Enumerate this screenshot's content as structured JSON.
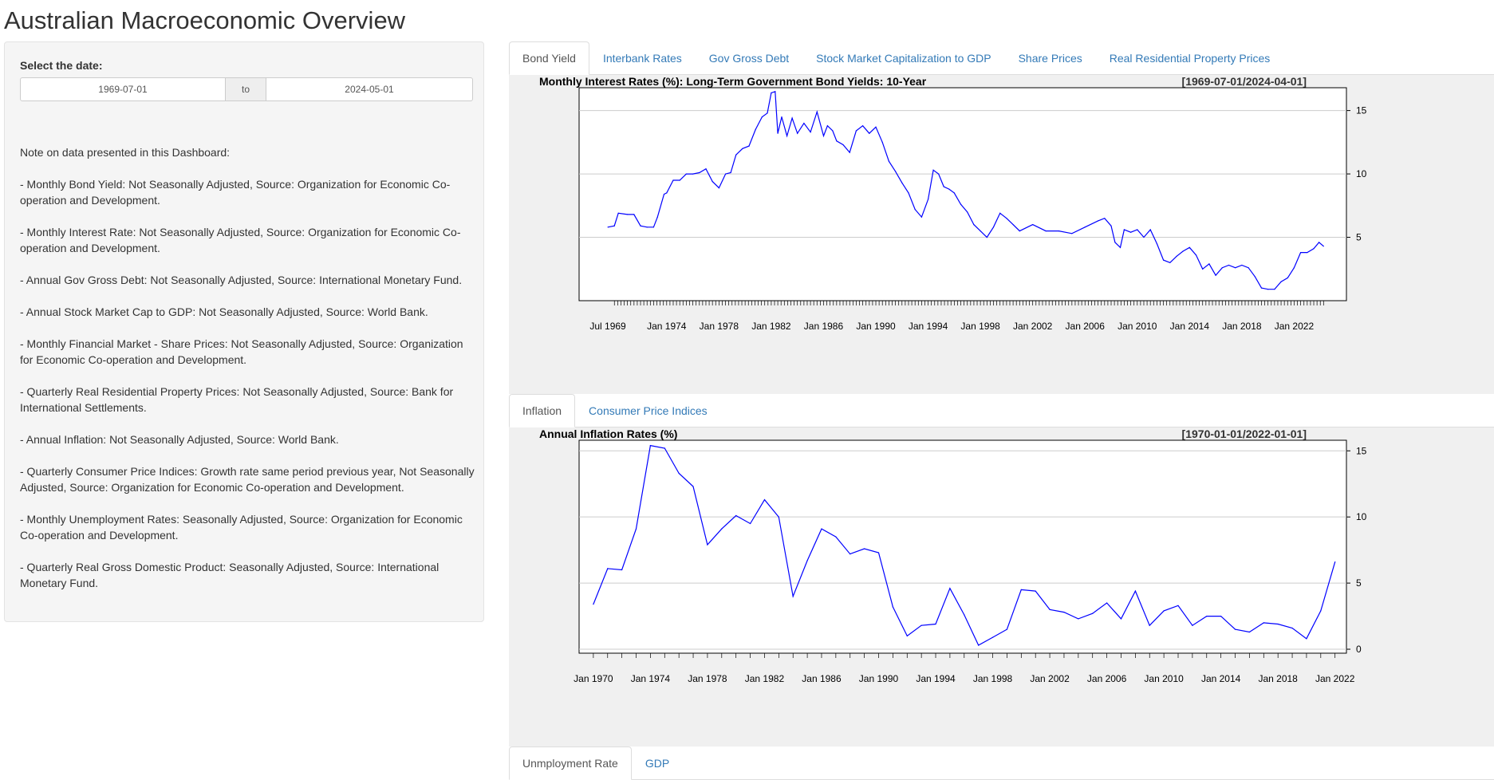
{
  "page": {
    "title": "Australian Macroeconomic Overview"
  },
  "sidebar": {
    "date_label": "Select the date:",
    "date_start": "1969-07-01",
    "date_separator": "to",
    "date_end": "2024-05-01",
    "notes_heading": "Note on data presented in this Dashboard:",
    "notes": [
      "- Monthly Bond Yield: Not Seasonally Adjusted, Source: Organization for Economic Co-operation and Development.",
      "- Monthly Interest Rate: Not Seasonally Adjusted, Source: Organization for Economic Co-operation and Development.",
      "- Annual Gov Gross Debt: Not Seasonally Adjusted, Source: International Monetary Fund.",
      "- Annual Stock Market Cap to GDP: Not Seasonally Adjusted, Source: World Bank.",
      "- Monthly Financial Market - Share Prices: Not Seasonally Adjusted, Source: Organization for Economic Co-operation and Development.",
      "- Quarterly Real Residential Property Prices: Not Seasonally Adjusted, Source: Bank for International Settlements.",
      "- Annual Inflation: Not Seasonally Adjusted, Source: World Bank.",
      "- Quarterly Consumer Price Indices: Growth rate same period previous year, Not Seasonally Adjusted, Source: Organization for Economic Co-operation and Development.",
      "- Monthly Unemployment Rates: Seasonally Adjusted, Source: Organization for Economic Co-operation and Development.",
      "- Quarterly Real Gross Domestic Product: Seasonally Adjusted, Source: International Monetary Fund."
    ]
  },
  "tabset1": {
    "tabs": [
      "Bond Yield",
      "Interbank Rates",
      "Gov Gross Debt",
      "Stock Market Capitalization to GDP",
      "Share Prices",
      "Real Residential Property Prices"
    ],
    "active": 0
  },
  "tabset2": {
    "tabs": [
      "Inflation",
      "Consumer Price Indices"
    ],
    "active": 0
  },
  "tabset3": {
    "tabs": [
      "Unmployment Rate",
      "GDP"
    ],
    "active": 0
  },
  "colors": {
    "line": "#0000ff",
    "tab_link": "#337ab7",
    "panel_bg": "#f0f0f0"
  },
  "chart_data": [
    {
      "type": "line",
      "title": "Monthly Interest Rates (%): Long-Term Government Bond Yields: 10-Year",
      "range_label": "[1969-07-01/2024-04-01]",
      "x_ticks": [
        "Jul 1969",
        "Jan 1974",
        "Jan 1978",
        "Jan 1982",
        "Jan 1986",
        "Jan 1990",
        "Jan 1994",
        "Jan 1998",
        "Jan 2002",
        "Jan 2006",
        "Jan 2010",
        "Jan 2014",
        "Jan 2018",
        "Jan 2022"
      ],
      "x_tick_years": [
        1969.5,
        1974,
        1978,
        1982,
        1986,
        1990,
        1994,
        1998,
        2002,
        2006,
        2010,
        2014,
        2018,
        2022
      ],
      "xlim": [
        1967.3,
        2026.0
      ],
      "ylim": [
        0,
        16.8
      ],
      "y_ticks": [
        5,
        10,
        15
      ],
      "grid": true,
      "x": [
        1969.5,
        1970.0,
        1970.3,
        1971.0,
        1971.5,
        1972.0,
        1972.5,
        1973.0,
        1973.3,
        1973.8,
        1974.0,
        1974.5,
        1975.0,
        1975.5,
        1976.0,
        1976.5,
        1977.0,
        1977.5,
        1978.0,
        1978.5,
        1978.9,
        1979.3,
        1979.8,
        1980.3,
        1980.8,
        1981.3,
        1981.7,
        1982.0,
        1982.3,
        1982.5,
        1982.8,
        1983.2,
        1983.6,
        1984.0,
        1984.5,
        1985.0,
        1985.5,
        1986.0,
        1986.3,
        1986.7,
        1987.0,
        1987.5,
        1988.0,
        1988.5,
        1989.0,
        1989.5,
        1990.0,
        1990.5,
        1991.0,
        1991.5,
        1992.0,
        1992.5,
        1993.0,
        1993.5,
        1994.0,
        1994.4,
        1994.8,
        1995.2,
        1995.6,
        1996.0,
        1996.5,
        1997.0,
        1997.5,
        1998.0,
        1998.5,
        1999.0,
        1999.5,
        2000.0,
        2000.5,
        2001.0,
        2002.0,
        2003.0,
        2004.0,
        2005.0,
        2006.0,
        2007.0,
        2007.5,
        2008.0,
        2008.3,
        2008.7,
        2009.0,
        2009.5,
        2010.0,
        2010.5,
        2011.0,
        2011.5,
        2012.0,
        2012.5,
        2013.0,
        2013.5,
        2014.0,
        2014.5,
        2015.0,
        2015.5,
        2016.0,
        2016.5,
        2017.0,
        2017.5,
        2018.0,
        2018.5,
        2019.0,
        2019.5,
        2020.0,
        2020.5,
        2021.0,
        2021.5,
        2022.0,
        2022.5,
        2023.0,
        2023.5,
        2023.9,
        2024.25
      ],
      "y": [
        5.8,
        5.9,
        6.9,
        6.8,
        6.8,
        5.9,
        5.8,
        5.8,
        6.6,
        8.4,
        8.5,
        9.5,
        9.5,
        10.0,
        10.0,
        10.1,
        10.4,
        9.4,
        8.9,
        10.0,
        10.1,
        11.5,
        12.0,
        12.2,
        13.5,
        14.5,
        14.8,
        16.4,
        16.5,
        13.2,
        14.5,
        13.0,
        14.4,
        13.2,
        14.0,
        13.3,
        14.9,
        13.0,
        13.8,
        13.4,
        12.6,
        12.3,
        11.7,
        13.4,
        13.8,
        13.2,
        13.7,
        12.5,
        11.0,
        10.2,
        9.3,
        8.5,
        7.2,
        6.6,
        8.0,
        10.3,
        10.0,
        9.0,
        8.8,
        8.5,
        7.6,
        7.0,
        6.0,
        5.5,
        5.0,
        5.8,
        6.9,
        6.5,
        6.0,
        5.5,
        6.0,
        5.5,
        5.5,
        5.3,
        5.8,
        6.3,
        6.5,
        5.9,
        4.6,
        4.2,
        5.6,
        5.4,
        5.6,
        5.0,
        5.6,
        4.5,
        3.2,
        3.0,
        3.5,
        3.9,
        4.2,
        3.6,
        2.5,
        2.9,
        2.0,
        2.6,
        2.8,
        2.6,
        2.8,
        2.6,
        1.9,
        1.0,
        0.9,
        0.9,
        1.5,
        1.8,
        2.6,
        3.8,
        3.8,
        4.1,
        4.6,
        4.3
      ]
    },
    {
      "type": "line",
      "title": "Annual Inflation Rates (%)",
      "range_label": "[1970-01-01/2022-01-01]",
      "x_ticks": [
        "Jan 1970",
        "Jan 1974",
        "Jan 1978",
        "Jan 1982",
        "Jan 1986",
        "Jan 1990",
        "Jan 1994",
        "Jan 1998",
        "Jan 2002",
        "Jan 2006",
        "Jan 2010",
        "Jan 2014",
        "Jan 2018",
        "Jan 2022"
      ],
      "ylim": [
        -0.3,
        15.8
      ],
      "y_ticks": [
        0,
        5,
        10,
        15
      ],
      "grid": true,
      "x": [
        1970,
        1971,
        1972,
        1973,
        1974,
        1975,
        1976,
        1977,
        1978,
        1979,
        1980,
        1981,
        1982,
        1983,
        1984,
        1985,
        1986,
        1987,
        1988,
        1989,
        1990,
        1991,
        1992,
        1993,
        1994,
        1995,
        1996,
        1997,
        1998,
        1999,
        2000,
        2001,
        2002,
        2003,
        2004,
        2005,
        2006,
        2007,
        2008,
        2009,
        2010,
        2011,
        2012,
        2013,
        2014,
        2015,
        2016,
        2017,
        2018,
        2019,
        2020,
        2021,
        2022
      ],
      "y": [
        3.4,
        6.1,
        6.0,
        9.1,
        15.4,
        15.2,
        13.3,
        12.3,
        7.9,
        9.1,
        10.1,
        9.5,
        11.3,
        10.0,
        4.0,
        6.7,
        9.1,
        8.5,
        7.2,
        7.6,
        7.3,
        3.2,
        1.0,
        1.8,
        1.9,
        4.6,
        2.6,
        0.3,
        0.9,
        1.5,
        4.5,
        4.4,
        3.0,
        2.8,
        2.3,
        2.7,
        3.5,
        2.3,
        4.4,
        1.8,
        2.9,
        3.3,
        1.8,
        2.5,
        2.5,
        1.5,
        1.3,
        2.0,
        1.9,
        1.6,
        0.8,
        2.9,
        6.6
      ]
    }
  ]
}
